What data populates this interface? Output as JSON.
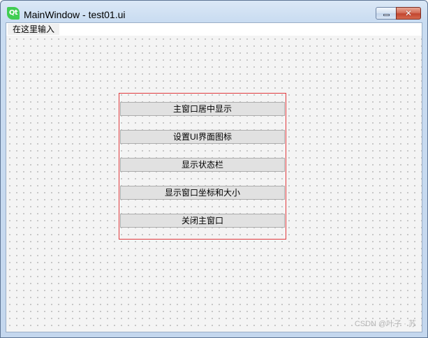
{
  "window": {
    "title": "MainWindow - test01.ui",
    "icon": "qt-logo-icon",
    "icon_text": "Qt"
  },
  "controls": {
    "minimize_icon": "minimize-icon",
    "close_icon": "close-icon",
    "close_glyph": "✕"
  },
  "menubar": {
    "items": [
      {
        "label": "在这里输入"
      }
    ]
  },
  "buttons": [
    {
      "label": "主窗口居中显示"
    },
    {
      "label": "设置UI界面图标"
    },
    {
      "label": "显示状态栏"
    },
    {
      "label": "显示窗口坐标和大小"
    },
    {
      "label": "关闭主窗口"
    }
  ],
  "watermark": "CSDN @叶子 · 苏",
  "colors": {
    "layout_border": "#e0393d",
    "qt_green": "#41cd52",
    "button_face": "#e1e1e1"
  }
}
